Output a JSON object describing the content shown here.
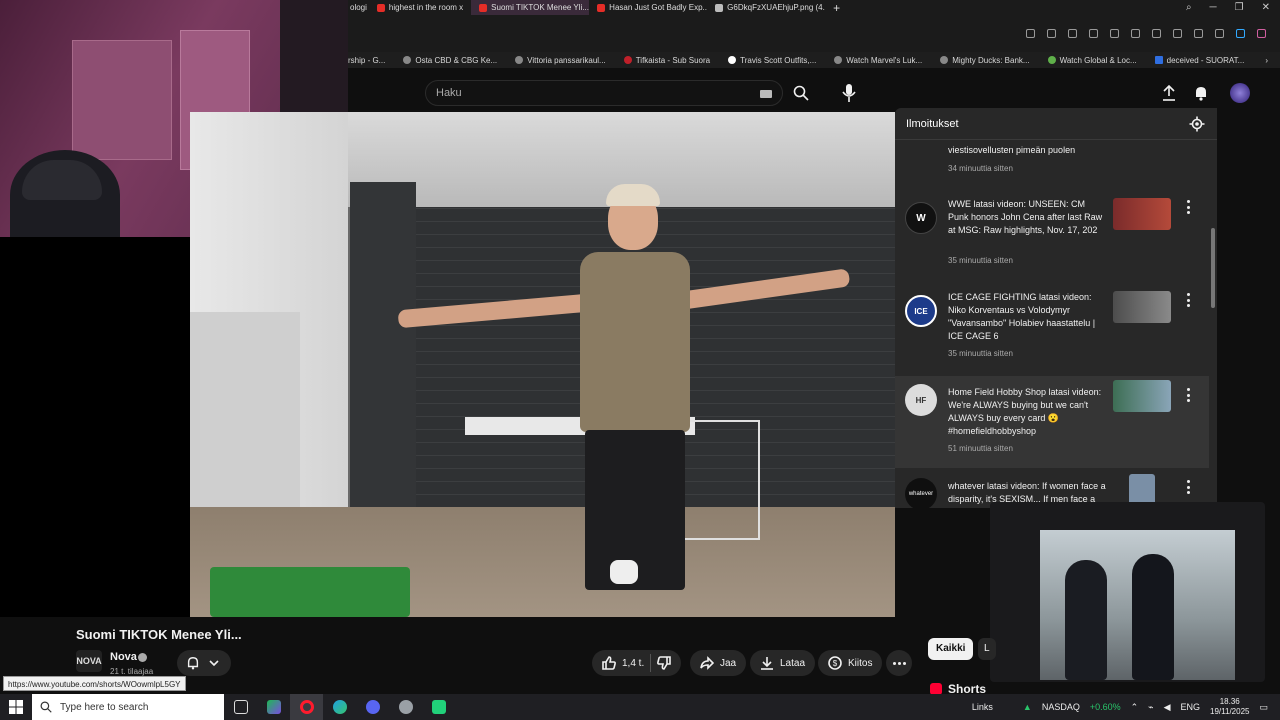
{
  "browser": {
    "tabs": [
      {
        "label": "ologi"
      },
      {
        "label": "highest in the room x"
      },
      {
        "label": "Suomi TIKTOK Menee Yli...",
        "active": true
      },
      {
        "label": "Hasan Just Got Badly Exp..."
      },
      {
        "label": "G6DkqFzXUAEhjuP.png (4..."
      }
    ],
    "new_tab": "+",
    "bookmarks": [
      "rship - G...",
      "Osta CBD & CBG Ke...",
      "Vittoria panssarikaul...",
      "Tifkaista - Sub Suora",
      "Travis Scott Outfits,...",
      "Watch Marvel's Luk...",
      "Mighty Ducks: Bank...",
      "Watch Global & Loc...",
      "deceived - SUORAT..."
    ],
    "bookmarks_more": "›"
  },
  "youtube": {
    "search_placeholder": "Haku",
    "video_title": "Suomi TIKTOK Menee Yli...",
    "channel": {
      "name": "Nova",
      "subs": "21 t. tilaajaa",
      "logo_text": "NOVA"
    },
    "actions": {
      "likes": "1,4 t.",
      "share": "Jaa",
      "download": "Lataa",
      "thanks": "Kiitos"
    },
    "chips": {
      "all": "Kaikki",
      "next": "L"
    },
    "shorts": "Shorts",
    "status_url": "https://www.youtube.com/shorts/WOowmlpL5GY"
  },
  "notifications": {
    "title": "Ilmoitukset",
    "previous": {
      "text": "viestisovellusten pimeän puolen",
      "time": "34 minuuttia sitten"
    },
    "items": [
      {
        "avatar": "W",
        "avatar_color": "#111111",
        "text": "WWE latasi videon: UNSEEN: CM Punk honors John Cena after last Raw at MSG: Raw highlights, Nov. 17, 202",
        "time": "35 minuuttia sitten",
        "thumb_color": "#7a2b2b"
      },
      {
        "avatar": "ICE",
        "avatar_color": "#1d3b8a",
        "text": "ICE CAGE FIGHTING latasi videon: Niko Korventaus vs Volodymyr \"Vavansambo\" Holabiev haastattelu | ICE CAGE 6",
        "time": "35 minuuttia sitten",
        "thumb_color": "#5a5a5a"
      },
      {
        "avatar": "HF",
        "avatar_color": "#dcdcdc",
        "text": "Home Field Hobby Shop latasi videon: We're ALWAYS buying but we can't ALWAYS buy every card 😮 #homefieldhobbyshop",
        "time": "51 minuuttia sitten",
        "thumb_color": "#4a7a5a"
      },
      {
        "avatar": "whatever",
        "avatar_color": "#0f0f0f",
        "text": "whatever latasi videon: If women face a disparity, it's SEXISM... If men face a disp... own fault.",
        "time": "",
        "thumb_color": "#7a8fa6"
      }
    ]
  },
  "taskbar": {
    "search_placeholder": "Type here to search",
    "links": "Links",
    "ticker": "NASDAQ",
    "ticker_change": "+0.60%",
    "lang": "ENG",
    "time": "18.36",
    "date": "19/11/2025"
  },
  "colors": {
    "accent_red": "#ff0033",
    "positive": "#29c46a",
    "panel": "#282828"
  }
}
